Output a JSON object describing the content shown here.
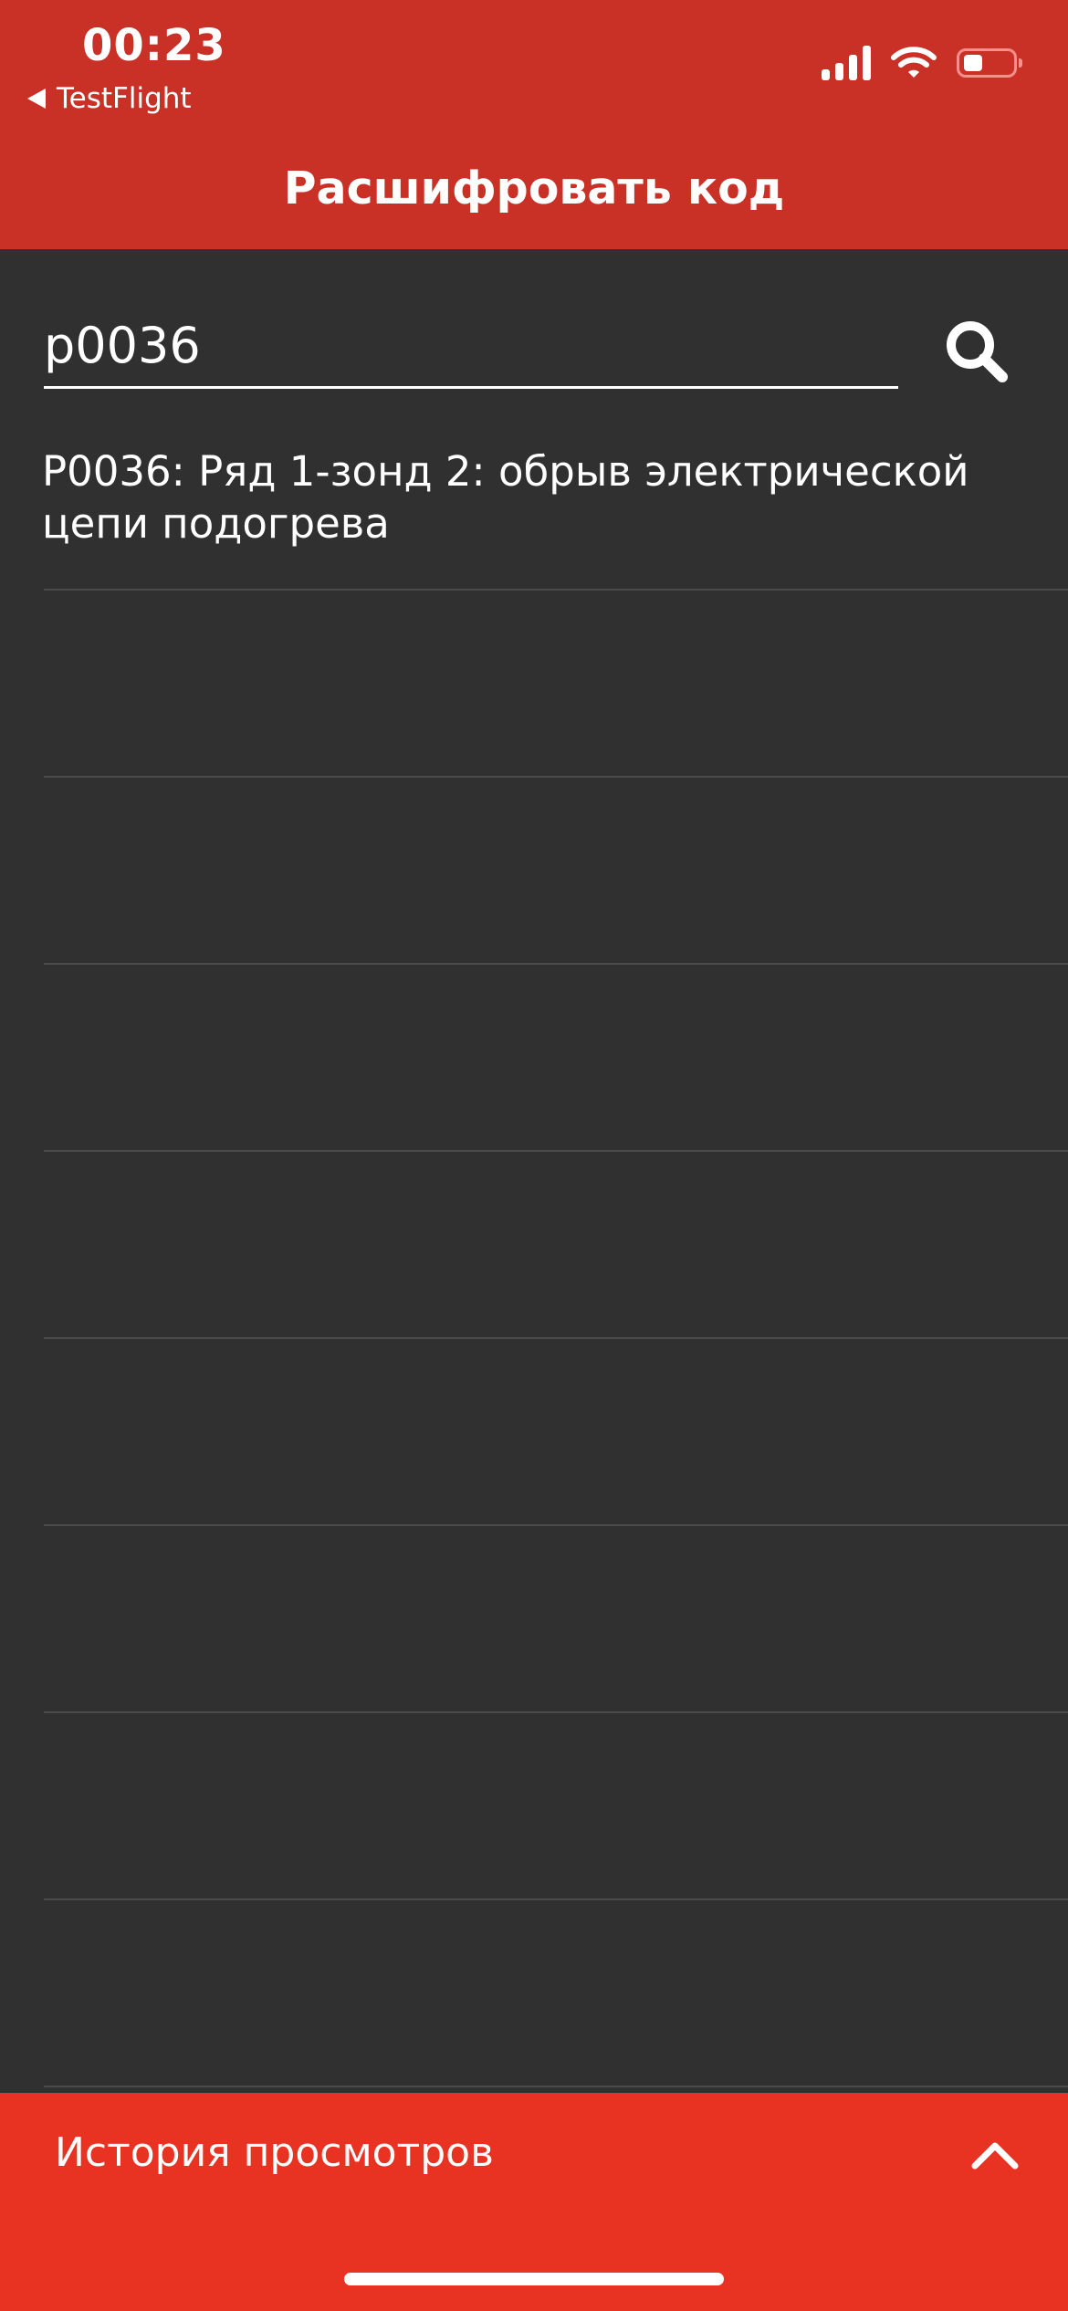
{
  "status_bar": {
    "time": "00:23",
    "back_app": "TestFlight",
    "icons": [
      "signal-icon",
      "wifi-icon",
      "battery-icon"
    ]
  },
  "nav": {
    "title": "Расшифровать код"
  },
  "search": {
    "value": "p0036",
    "button_icon": "search-icon"
  },
  "results": [
    {
      "text": "P0036: Ряд 1-зонд 2: обрыв электрической цепи подогрева"
    }
  ],
  "history": {
    "label": "История просмотров",
    "toggle_icon": "chevron-up-icon"
  },
  "colors": {
    "header": "#c93126",
    "background": "#303030",
    "history_bar": "#e83323",
    "divider": "#4b4b4b",
    "text": "#ffffff"
  }
}
